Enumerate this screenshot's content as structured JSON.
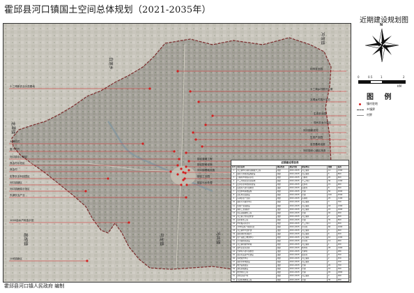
{
  "header": {
    "title": "霍邱县河口镇国土空间总体规划（2021-2035年）",
    "subtitle": "近期建设规划图"
  },
  "footer": {
    "credit": "霍邱县河口镇人民政府  编制"
  },
  "map": {
    "neighbors": {
      "north": "白莲乡",
      "northeast": "冯瓴镇",
      "west": "龙潭镇",
      "southwest": "扈胡镇",
      "south": "乌龙镇",
      "southeast": "冯井镇"
    },
    "labels_left": [
      "十三湾新农业示范基地",
      "大碑村式",
      "复兴村式",
      "河口镇中心镇区",
      "良会村示范区",
      "良会村",
      "宏泰农业科技园区",
      "河口镇镇区",
      "河口镇蔬菜示范区",
      "东湖农业产业",
      "1000亩水产科技示范",
      "沙河镇新区"
    ],
    "labels_right": [
      "利市农业园",
      "十三湾乡村振兴二期",
      "万顺乡村振兴示范",
      "生态农业园",
      "现代农业示范区",
      "河口镇新农村",
      "生态产业园",
      "农田基础设施",
      "河口镇中心镇区改造",
      "镇区道路工程",
      "镇区配套设施",
      "河口镇基础设施",
      "镇区工业园",
      "镇区污水处理"
    ]
  },
  "right_panel": {
    "scale_label": "KM",
    "scale_ticks": [
      "0",
      "0.5",
      "1",
      "2"
    ],
    "legend_title": "图  例",
    "legend": [
      {
        "label": "镇村驻地",
        "icon": "red-dot-icon",
        "color": "#d62020"
      },
      {
        "label": "乡镇界",
        "icon": "dashed-line-icon",
        "color": "#444444"
      },
      {
        "label": "村界",
        "icon": "thin-line-icon",
        "color": "#888888"
      }
    ]
  },
  "project_table": {
    "title": "近期建设项目表",
    "columns": [
      "序号",
      "项目名称",
      "建设性质",
      "建设年限",
      "建设地点",
      "规模",
      "投资"
    ],
    "rows": [
      [
        "1",
        "河口镇中心镇区道路提升工程",
        "新建",
        "2021-2025",
        "河口镇区",
        "12",
        "1500"
      ],
      [
        "2",
        "镇区污水处理设施建设",
        "新建",
        "2021-2025",
        "河口镇区",
        "5",
        "800"
      ],
      [
        "3",
        "万顺村乡村振兴示范",
        "新建",
        "2021-2025",
        "万顺村",
        "20",
        "600"
      ],
      [
        "4",
        "十三湾新农业示范基地",
        "新建",
        "2021-2025",
        "十三湾村",
        "30",
        "1200"
      ],
      [
        "5",
        "宏泰农业科技园区建设",
        "新建",
        "2021-2025",
        "宏泰村",
        "15",
        "900"
      ],
      [
        "6",
        "良会村人居环境整治",
        "改建",
        "2021-2025",
        "良会村",
        "8",
        "300"
      ],
      [
        "7",
        "农田水利基础设施",
        "新建",
        "2021-2025",
        "全镇",
        "50",
        "2000"
      ],
      [
        "8",
        "高标准农田建设",
        "新建",
        "2021-2025",
        "全镇",
        "100",
        "2500"
      ],
      [
        "9",
        "东湖农业产业园",
        "新建",
        "2021-2025",
        "东湖村",
        "25",
        "1100"
      ],
      [
        "10",
        "镇区公共服务中心",
        "新建",
        "2021-2025",
        "河口镇区",
        "3",
        "700"
      ],
      [
        "11",
        "生态产业园建设",
        "新建",
        "2021-2025",
        "河口镇区",
        "18",
        "1300"
      ],
      [
        "12",
        "镇区工业园提升",
        "改建",
        "2021-2025",
        "河口镇区",
        "22",
        "1600"
      ],
      [
        "13",
        "村庄道路硬化工程",
        "新建",
        "2021-2025",
        "全镇",
        "40",
        "900"
      ],
      [
        "14",
        "河口镇卫生院改扩建",
        "改建",
        "2021-2025",
        "河口镇区",
        "2",
        "500"
      ],
      [
        "15",
        "农村供水工程",
        "新建",
        "2021-2025",
        "全镇",
        "35",
        "800"
      ],
      [
        "16",
        "乡村振兴示范带",
        "新建",
        "2021-2025",
        "十三湾村",
        "12",
        "650"
      ],
      [
        "17",
        "1000亩水产科技示范",
        "新建",
        "2021-2025",
        "沙河村",
        "66",
        "1000"
      ],
      [
        "18",
        "河口镇中学改扩建",
        "改建",
        "2021-2025",
        "河口镇区",
        "3",
        "600"
      ],
      [
        "19",
        "镇区绿化景观提升",
        "改建",
        "2021-2025",
        "河口镇区",
        "6",
        "400"
      ],
      [
        "20",
        "农产品加工物流中心",
        "新建",
        "2021-2025",
        "河口镇区",
        "10",
        "1200"
      ],
      [
        "21",
        "沙河镇新区建设",
        "新建",
        "2021-2025",
        "沙河村",
        "14",
        "900"
      ],
      [
        "22",
        "河口镇垃圾中转站",
        "新建",
        "2021-2025",
        "河口镇区",
        "1",
        "200"
      ],
      [
        "23",
        "现代农业示范区",
        "新建",
        "2021-2025",
        "利市村",
        "28",
        "1400"
      ],
      [
        "24",
        "大碑村人居环境整治",
        "改建",
        "2021-2025",
        "大碑村",
        "7",
        "280"
      ],
      [
        "25",
        "复兴村美丽乡村建设",
        "改建",
        "2021-2025",
        "复兴村",
        "9",
        "350"
      ],
      [
        "26",
        "养老服务中心",
        "新建",
        "2021-2025",
        "河口镇区",
        "2",
        "450"
      ],
      [
        "27",
        "镇区停车场建设",
        "新建",
        "2021-2025",
        "河口镇区",
        "1",
        "150"
      ],
      [
        "28",
        "电力设施改造",
        "改建",
        "2021-2025",
        "全镇",
        "20",
        "700"
      ],
      [
        "29",
        "通信基站建设",
        "新建",
        "2021-2025",
        "全镇",
        "10",
        "300"
      ],
      [
        "30",
        "防洪排涝工程",
        "新建",
        "2021-2025",
        "全镇",
        "45",
        "1800"
      ],
      [
        "31",
        "文化活动广场",
        "新建",
        "2021-2025",
        "河口镇区",
        "2",
        "260"
      ],
      [
        "32",
        "河道生态修复工程",
        "新建",
        "2021-2025",
        "全镇",
        "30",
        "950"
      ],
      [
        "33",
        "农村电商服务站",
        "新建",
        "2021-2025",
        "全镇",
        "1",
        "120"
      ],
      [
        "34",
        "生态农业园建设",
        "新建",
        "2021-2025",
        "良会村",
        "16",
        "780"
      ],
      [
        "35",
        "镇区商业街改造",
        "改建",
        "2021-2025",
        "河口镇区",
        "4",
        "560"
      ],
      [
        "36",
        "农业机械服务中心",
        "新建",
        "2021-2025",
        "河口镇区",
        "2",
        "230"
      ],
      [
        "37",
        "乡村旅游配套设施",
        "新建",
        "2021-2025",
        "十三湾村",
        "5",
        "420"
      ],
      [
        "38",
        "镇区安置小区建设",
        "新建",
        "2021-2025",
        "河口镇区",
        "8",
        "2200"
      ]
    ]
  }
}
